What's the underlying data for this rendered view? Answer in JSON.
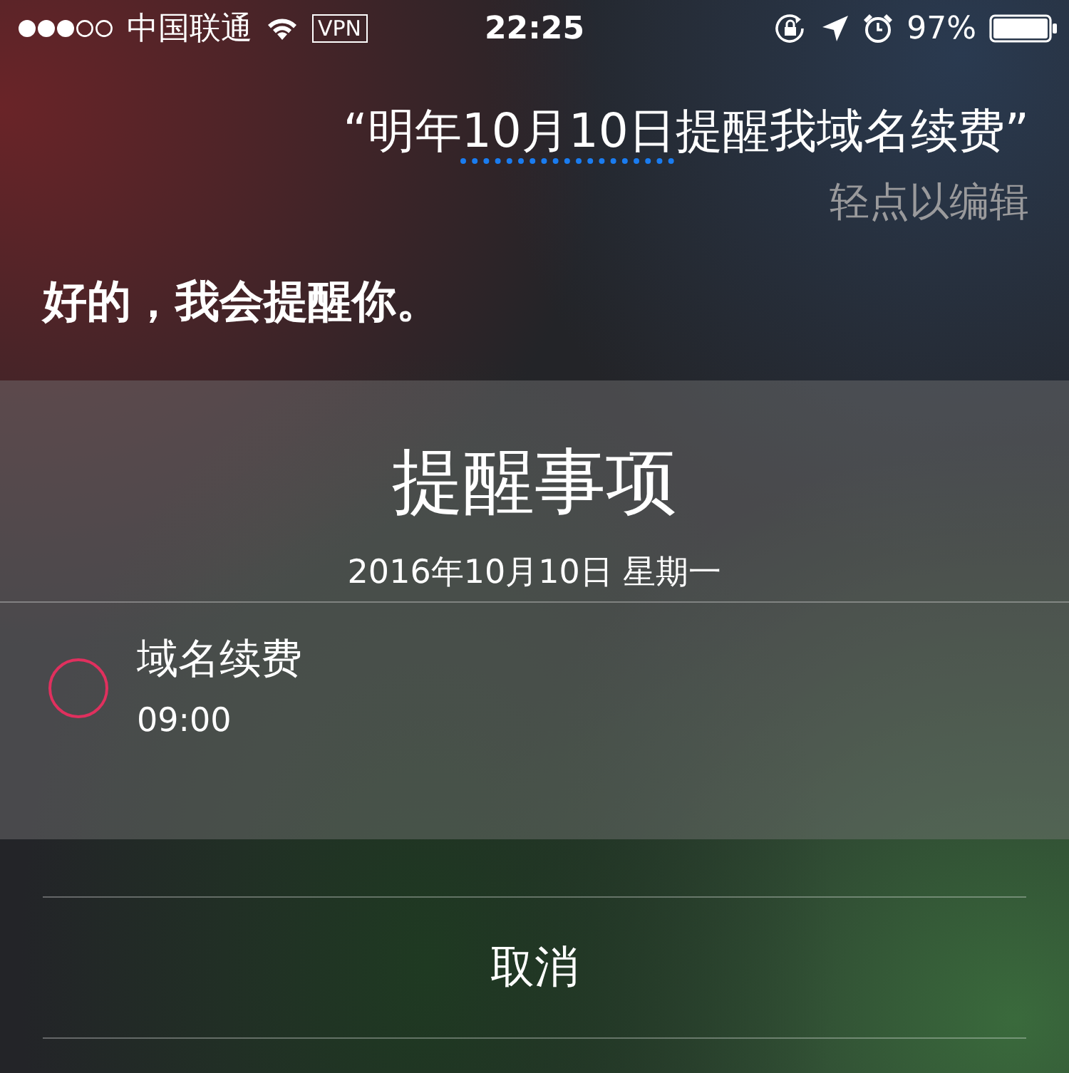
{
  "status_bar": {
    "carrier": "中国联通",
    "vpn": "VPN",
    "time": "22:25",
    "battery": "97%"
  },
  "query": {
    "before": "“明年",
    "link": "10月10日",
    "after": "提醒我域名续费”",
    "hint": "轻点以编辑"
  },
  "response": "好的，我会提醒你。",
  "card": {
    "title": "提醒事项",
    "date": "2016年10月10日 星期一",
    "items": [
      {
        "title": "域名续费",
        "time": "09:00",
        "completed": false
      }
    ]
  },
  "cancel": "取消"
}
